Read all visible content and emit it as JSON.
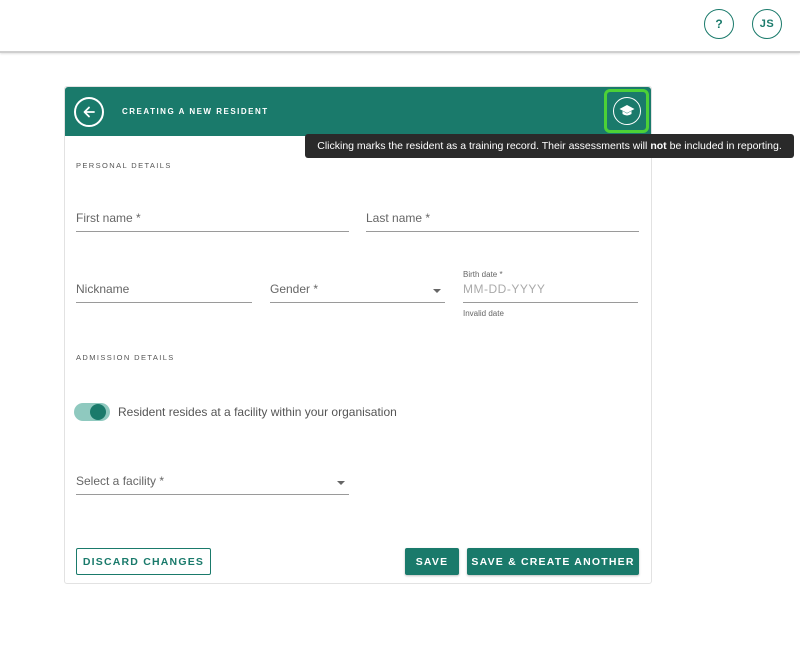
{
  "topbar": {
    "help_label": "?",
    "avatar_initials": "JS"
  },
  "card": {
    "header_title": "CREATING A NEW RESIDENT",
    "back_icon": "arrow-left-icon",
    "training_icon": "graduation-cap-icon"
  },
  "tooltip": {
    "text_before": "Clicking marks the resident as a training record. Their assessments will",
    "text_bold": "not",
    "text_after": "be included in reporting."
  },
  "personal": {
    "section_label": "PERSONAL DETAILS",
    "first_name_placeholder": "First name *",
    "last_name_placeholder": "Last name *",
    "nickname_placeholder": "Nickname",
    "gender_placeholder": "Gender *",
    "birth_date_label": "Birth date *",
    "birth_date_placeholder": "MM-DD-YYYY",
    "birth_date_error": "Invalid date"
  },
  "admission": {
    "section_label": "ADMISSION DETAILS",
    "toggle_label": "Resident resides at a facility within your organisation",
    "toggle_on": true,
    "facility_placeholder": "Select a facility *"
  },
  "actions": {
    "discard_label": "DISCARD CHANGES",
    "save_label": "SAVE",
    "save_another_label": "SAVE & CREATE ANOTHER"
  },
  "colors": {
    "primary": "#1a7a6b",
    "highlight": "#4cd137"
  }
}
